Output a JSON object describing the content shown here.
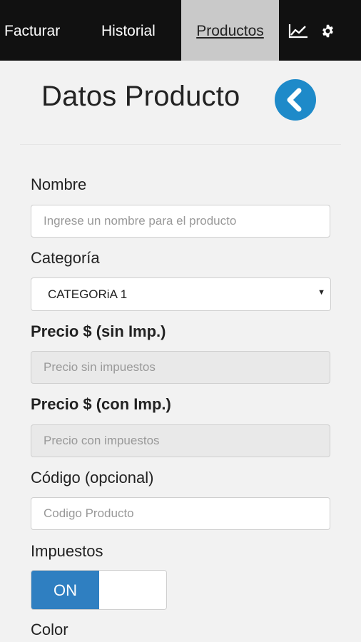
{
  "nav": {
    "items": [
      {
        "label": "Facturar"
      },
      {
        "label": "Historial"
      },
      {
        "label": "Productos"
      }
    ],
    "icons": [
      "chart-icon",
      "gear-icon"
    ]
  },
  "page": {
    "title": "Datos Producto"
  },
  "form": {
    "nombre": {
      "label": "Nombre",
      "placeholder": "Ingrese un nombre para el producto",
      "value": ""
    },
    "categoria": {
      "label": "Categoría",
      "selected": "CATEGORiA 1"
    },
    "precio_sin": {
      "label": "Precio $ (sin Imp.)",
      "placeholder": "Precio sin impuestos"
    },
    "precio_con": {
      "label": "Precio $ (con Imp.)",
      "placeholder": "Precio con impuestos"
    },
    "codigo": {
      "label": "Código (opcional)",
      "placeholder": "Codigo Producto"
    },
    "impuestos": {
      "label": "Impuestos",
      "toggle_label": "ON",
      "state": "on"
    },
    "color": {
      "label": "Color"
    }
  },
  "colors": {
    "nav_bg": "#111111",
    "active_tab_bg": "#c9c9c9",
    "accent": "#1e8ac9",
    "toggle_on": "#2f7fc1",
    "page_bg": "#f2f2f2"
  }
}
